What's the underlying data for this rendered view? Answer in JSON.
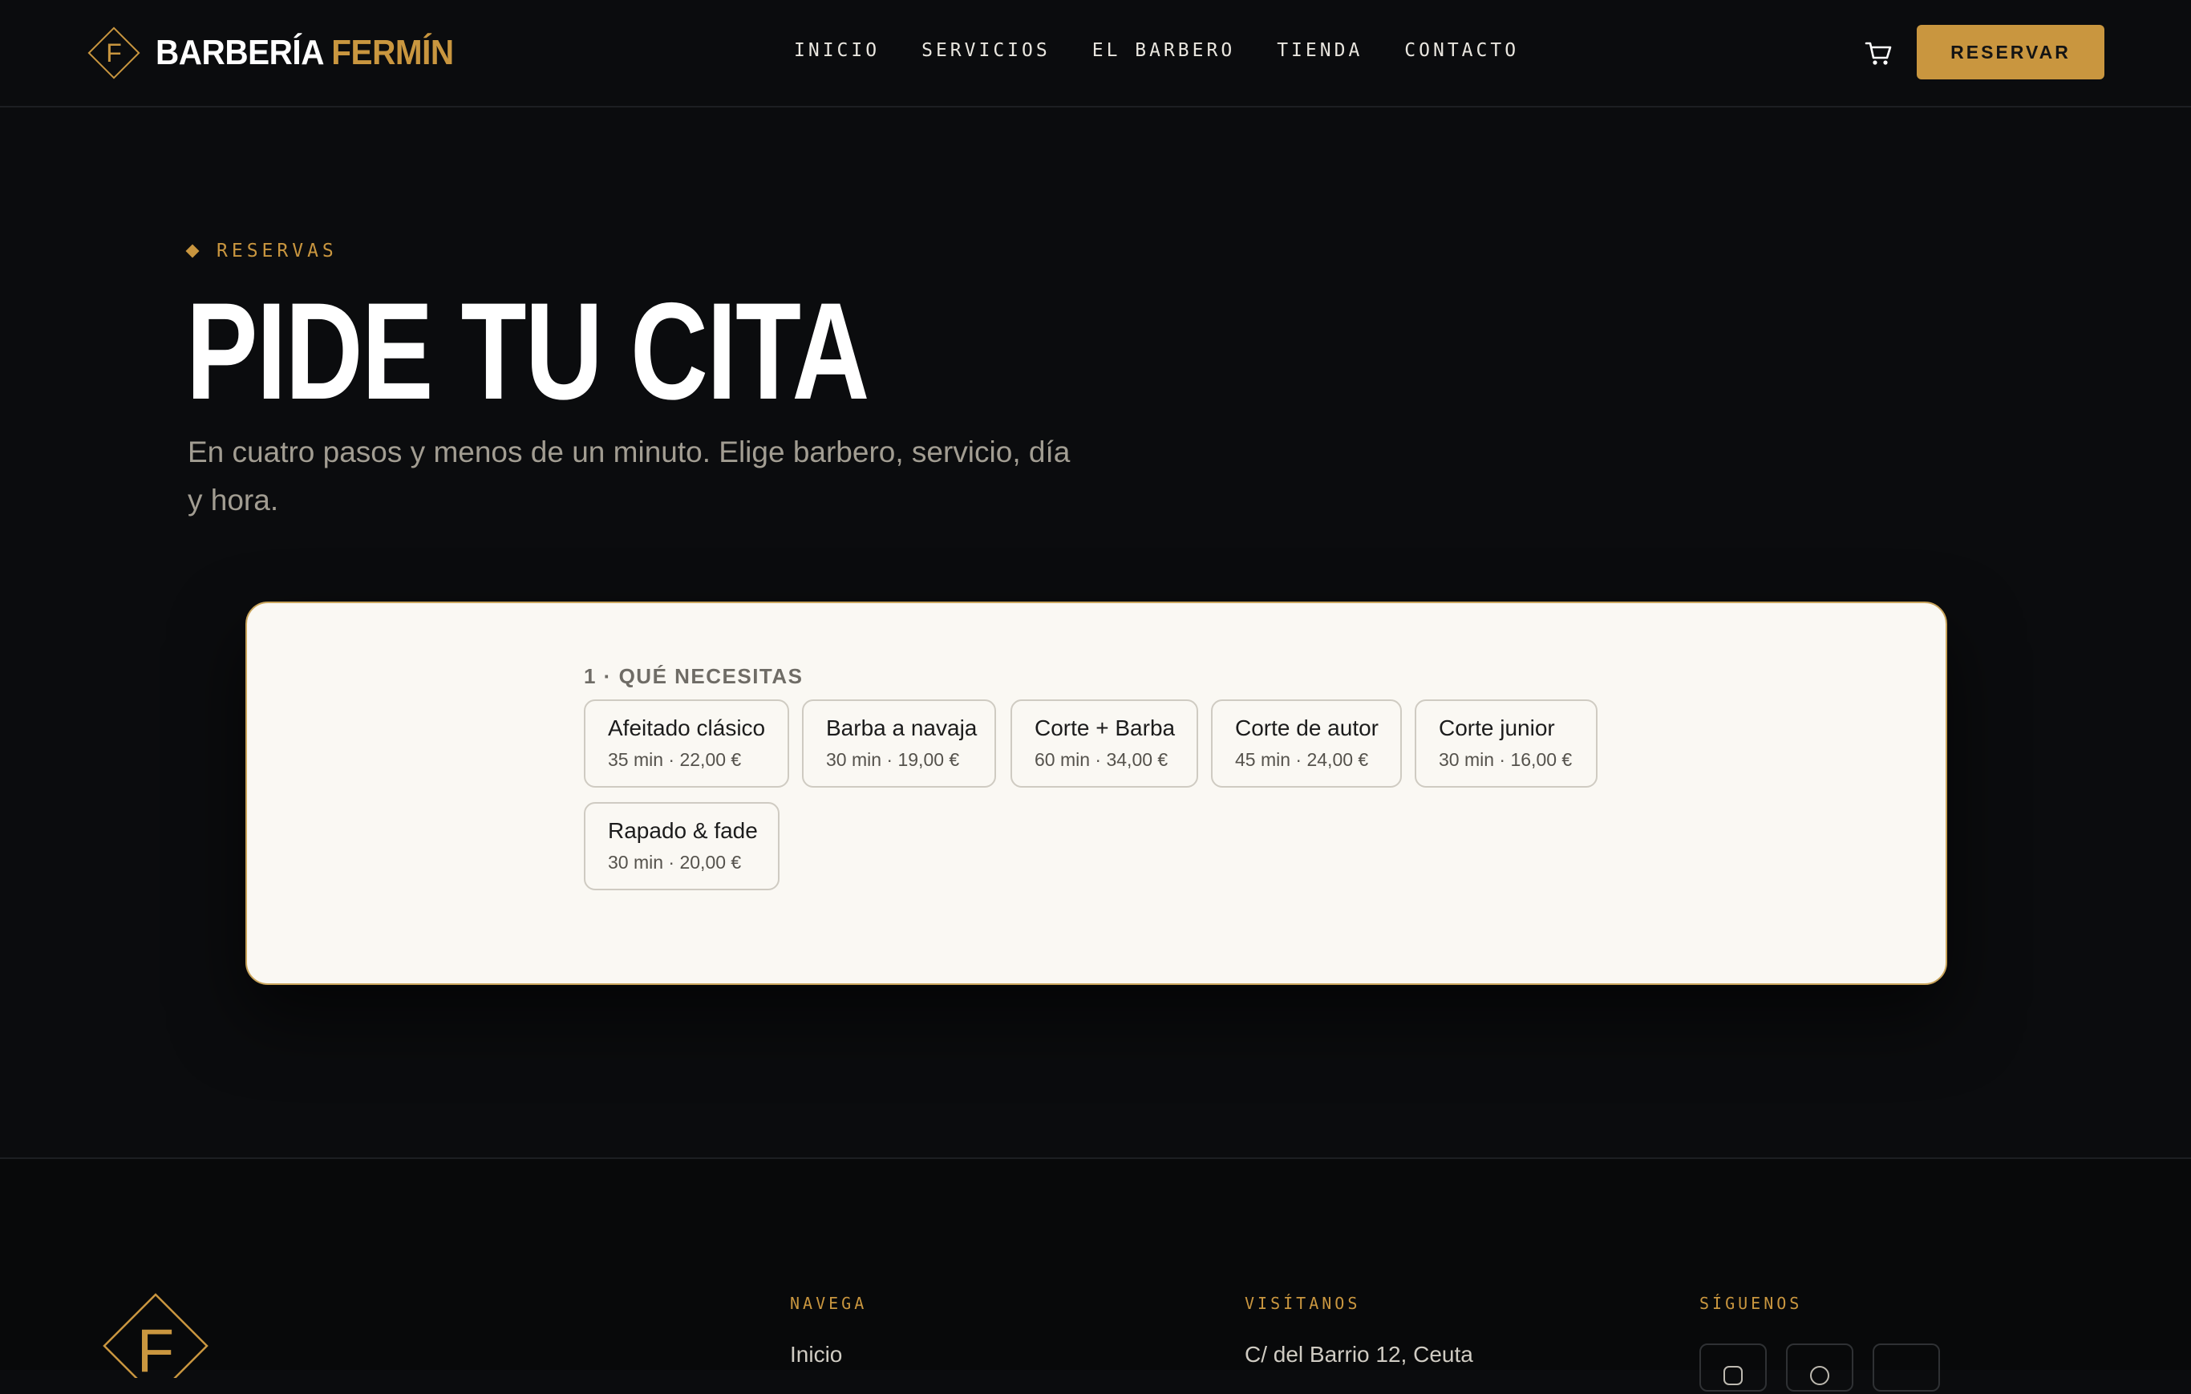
{
  "header": {
    "brand_white": "BARBERÍA",
    "brand_gold": "FERMÍN",
    "brand_mark_letter": "F",
    "nav": [
      "INICIO",
      "SERVICIOS",
      "EL BARBERO",
      "TIENDA",
      "CONTACTO"
    ],
    "cart_icon": "cart-icon",
    "reserve_label": "RESERVAR"
  },
  "hero": {
    "eyebrow": "RESERVAS",
    "title": "PIDE TU CITA",
    "subtitle": "En cuatro pasos y menos de un minuto. Elige barbero, servicio, día y hora."
  },
  "booking": {
    "step_label": "1 · QUÉ NECESITAS",
    "services": [
      {
        "name": "Afeitado clásico",
        "meta": "35 min · 22,00 €"
      },
      {
        "name": "Barba a navaja",
        "meta": "30 min · 19,00 €"
      },
      {
        "name": "Corte + Barba",
        "meta": "60 min · 34,00 €"
      },
      {
        "name": "Corte de autor",
        "meta": "45 min · 24,00 €"
      },
      {
        "name": "Corte junior",
        "meta": "30 min · 16,00 €"
      },
      {
        "name": "Rapado & fade",
        "meta": "30 min · 20,00 €"
      }
    ]
  },
  "footer": {
    "logo_letter": "F",
    "columns": [
      {
        "title": "NAVEGA",
        "first": "Inicio"
      },
      {
        "title": "VISÍTANOS",
        "first": "C/ del Barrio 12, Ceuta"
      },
      {
        "title": "SÍGUENOS"
      }
    ],
    "social_icons": [
      "instagram-icon",
      "whatsapp-icon",
      "social-icon"
    ]
  },
  "colors": {
    "background": "#0b0c0e",
    "accent": "#c9963f",
    "card": "#faf8f3"
  }
}
